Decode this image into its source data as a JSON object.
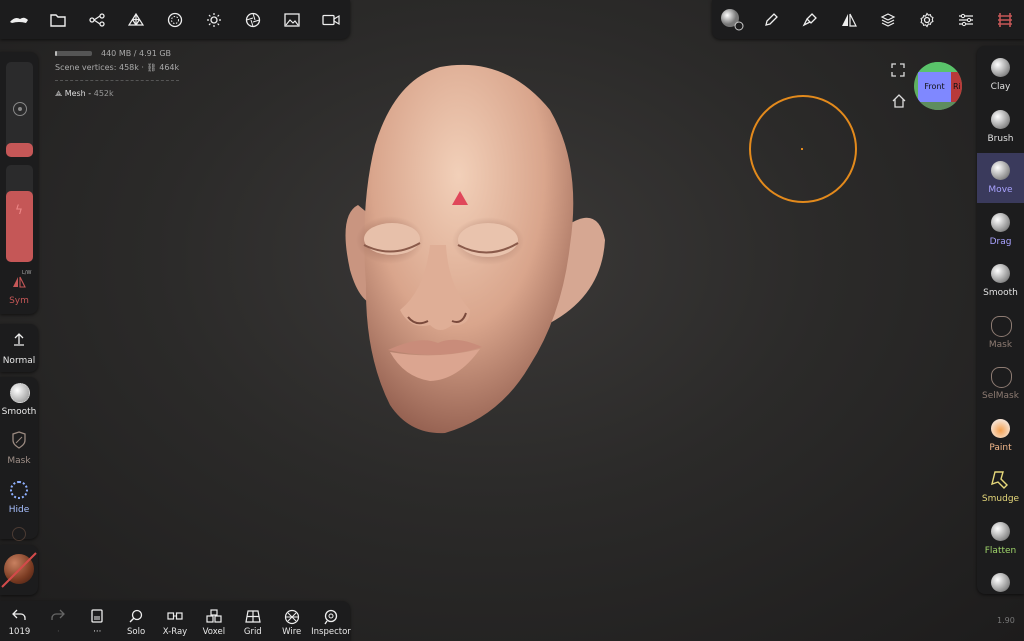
{
  "stats": {
    "memory": "440 MB / 4.91 GB",
    "memory_fill_fraction": 0.05,
    "scene_label": "Scene vertices",
    "scene_vertices": "458k",
    "scene_faces": "464k",
    "mesh_name": "Mesh",
    "mesh_count": "452k"
  },
  "left": {
    "sym_label": "Sym",
    "sym_tag": "L/W",
    "radius_fill_fraction": 0.15,
    "intensity_fill_fraction": 0.73,
    "normal_label": "Normal",
    "smooth_label": "Smooth",
    "mask_label": "Mask",
    "hide_label": "Hide"
  },
  "gizmo": {
    "front_label": "Front",
    "right_label": "Ri"
  },
  "tools": [
    {
      "label": "Clay",
      "color": "#e0e0e0"
    },
    {
      "label": "Brush",
      "color": "#e0e0e0"
    },
    {
      "label": "Move",
      "color": "#a9a3ff"
    },
    {
      "label": "Drag",
      "color": "#a9a3ff"
    },
    {
      "label": "Smooth",
      "color": "#e0e0e0"
    },
    {
      "label": "Mask",
      "color": "#8d7b72"
    },
    {
      "label": "SelMask",
      "color": "#8d7b72"
    },
    {
      "label": "Paint",
      "color": "#f3b88a"
    },
    {
      "label": "Smudge",
      "color": "#e5d77a"
    },
    {
      "label": "Flatten",
      "color": "#9fd46a"
    },
    {
      "label": "",
      "color": "#e0e0e0"
    }
  ],
  "bottom": {
    "undo_count": "1019",
    "solo_label": "Solo",
    "xray_label": "X-Ray",
    "voxel_label": "Voxel",
    "grid_label": "Grid",
    "wire_label": "Wire",
    "inspector_label": "Inspector",
    "version": "1.90"
  },
  "colors": {
    "accent_red": "#c55757",
    "active_tool": "#3a3a5c",
    "brush_ring": "#e38a1c"
  }
}
